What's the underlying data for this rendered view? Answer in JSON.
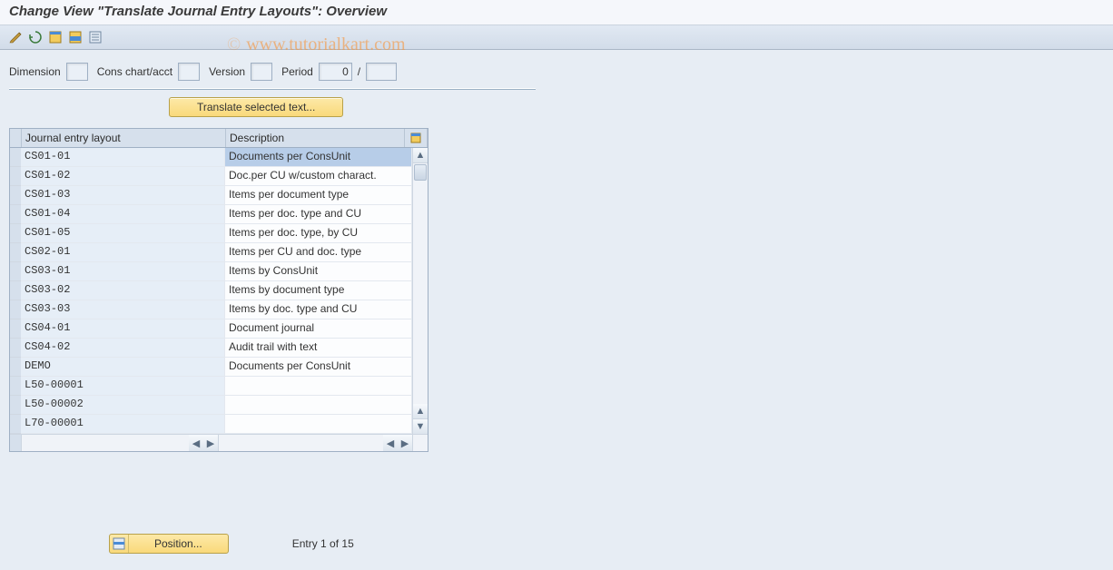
{
  "title": "Change View \"Translate Journal Entry Layouts\": Overview",
  "watermark": "www.tutorialkart.com",
  "filter": {
    "dimension_label": "Dimension",
    "cons_chart_label": "Cons chart/acct",
    "version_label": "Version",
    "period_label": "Period",
    "period_value": "0",
    "slash": "/"
  },
  "translate_button": "Translate selected text...",
  "table": {
    "col_layout": "Journal entry layout",
    "col_desc": "Description",
    "rows": [
      {
        "layout": "CS01-01",
        "desc": "Documents per ConsUnit",
        "selected": true
      },
      {
        "layout": "CS01-02",
        "desc": "Doc.per CU w/custom charact."
      },
      {
        "layout": "CS01-03",
        "desc": "Items per document type"
      },
      {
        "layout": "CS01-04",
        "desc": "Items per doc. type and CU"
      },
      {
        "layout": "CS01-05",
        "desc": "Items per doc. type, by CU"
      },
      {
        "layout": "CS02-01",
        "desc": "Items per CU and doc. type"
      },
      {
        "layout": "CS03-01",
        "desc": "Items by ConsUnit"
      },
      {
        "layout": "CS03-02",
        "desc": "Items by document type"
      },
      {
        "layout": "CS03-03",
        "desc": "Items by doc. type and CU"
      },
      {
        "layout": "CS04-01",
        "desc": "Document journal"
      },
      {
        "layout": "CS04-02",
        "desc": "Audit trail with text"
      },
      {
        "layout": "DEMO",
        "desc": "Documents per ConsUnit"
      },
      {
        "layout": "L50-00001",
        "desc": ""
      },
      {
        "layout": "L50-00002",
        "desc": ""
      },
      {
        "layout": "L70-00001",
        "desc": ""
      }
    ]
  },
  "position_button": "Position...",
  "entry_status": "Entry 1 of 15"
}
